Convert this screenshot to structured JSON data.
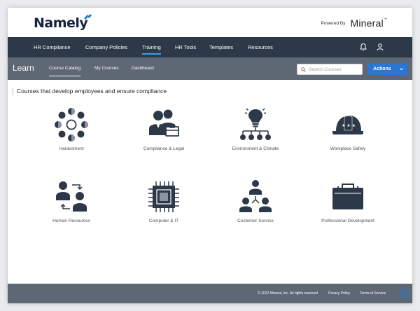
{
  "brand": {
    "logo_text": "Namely",
    "powered_by": "Powered By",
    "partner": "Mineral",
    "partner_tm": "™",
    "accent_color": "#2b76d2"
  },
  "main_nav": {
    "items": [
      {
        "label": "HR Compliance"
      },
      {
        "label": "Company Policies"
      },
      {
        "label": "Training",
        "active": true
      },
      {
        "label": "HR Tools"
      },
      {
        "label": "Templates"
      },
      {
        "label": "Resources"
      }
    ],
    "icons": [
      "bell-icon",
      "user-icon"
    ]
  },
  "sub_nav": {
    "title": "Learn",
    "tabs": [
      {
        "label": "Course Catalog",
        "active": true
      },
      {
        "label": "My Courses"
      },
      {
        "label": "Dashboard"
      }
    ],
    "search_placeholder": "Search Courses",
    "search_value": "",
    "actions_label": "Actions"
  },
  "content": {
    "heading": "Courses that develop employees and ensure compliance",
    "categories": [
      {
        "label": "Harassment",
        "icon": "people-circle-icon"
      },
      {
        "label": "Compliance & Legal",
        "icon": "businesspeople-icon"
      },
      {
        "label": "Environment & Climate",
        "icon": "lightbulb-network-icon"
      },
      {
        "label": "Workplace Safety",
        "icon": "hard-hat-icon"
      },
      {
        "label": "Human Resources",
        "icon": "people-exchange-icon"
      },
      {
        "label": "Computer & IT",
        "icon": "microchip-icon"
      },
      {
        "label": "Customer Service",
        "icon": "people-hierarchy-icon"
      },
      {
        "label": "Professional Development",
        "icon": "briefcase-icon"
      }
    ]
  },
  "footer": {
    "copyright": "© 2022 Mineral, Inc. All rights reserved",
    "links": [
      "Privacy Policy",
      "Terms of Service"
    ]
  }
}
